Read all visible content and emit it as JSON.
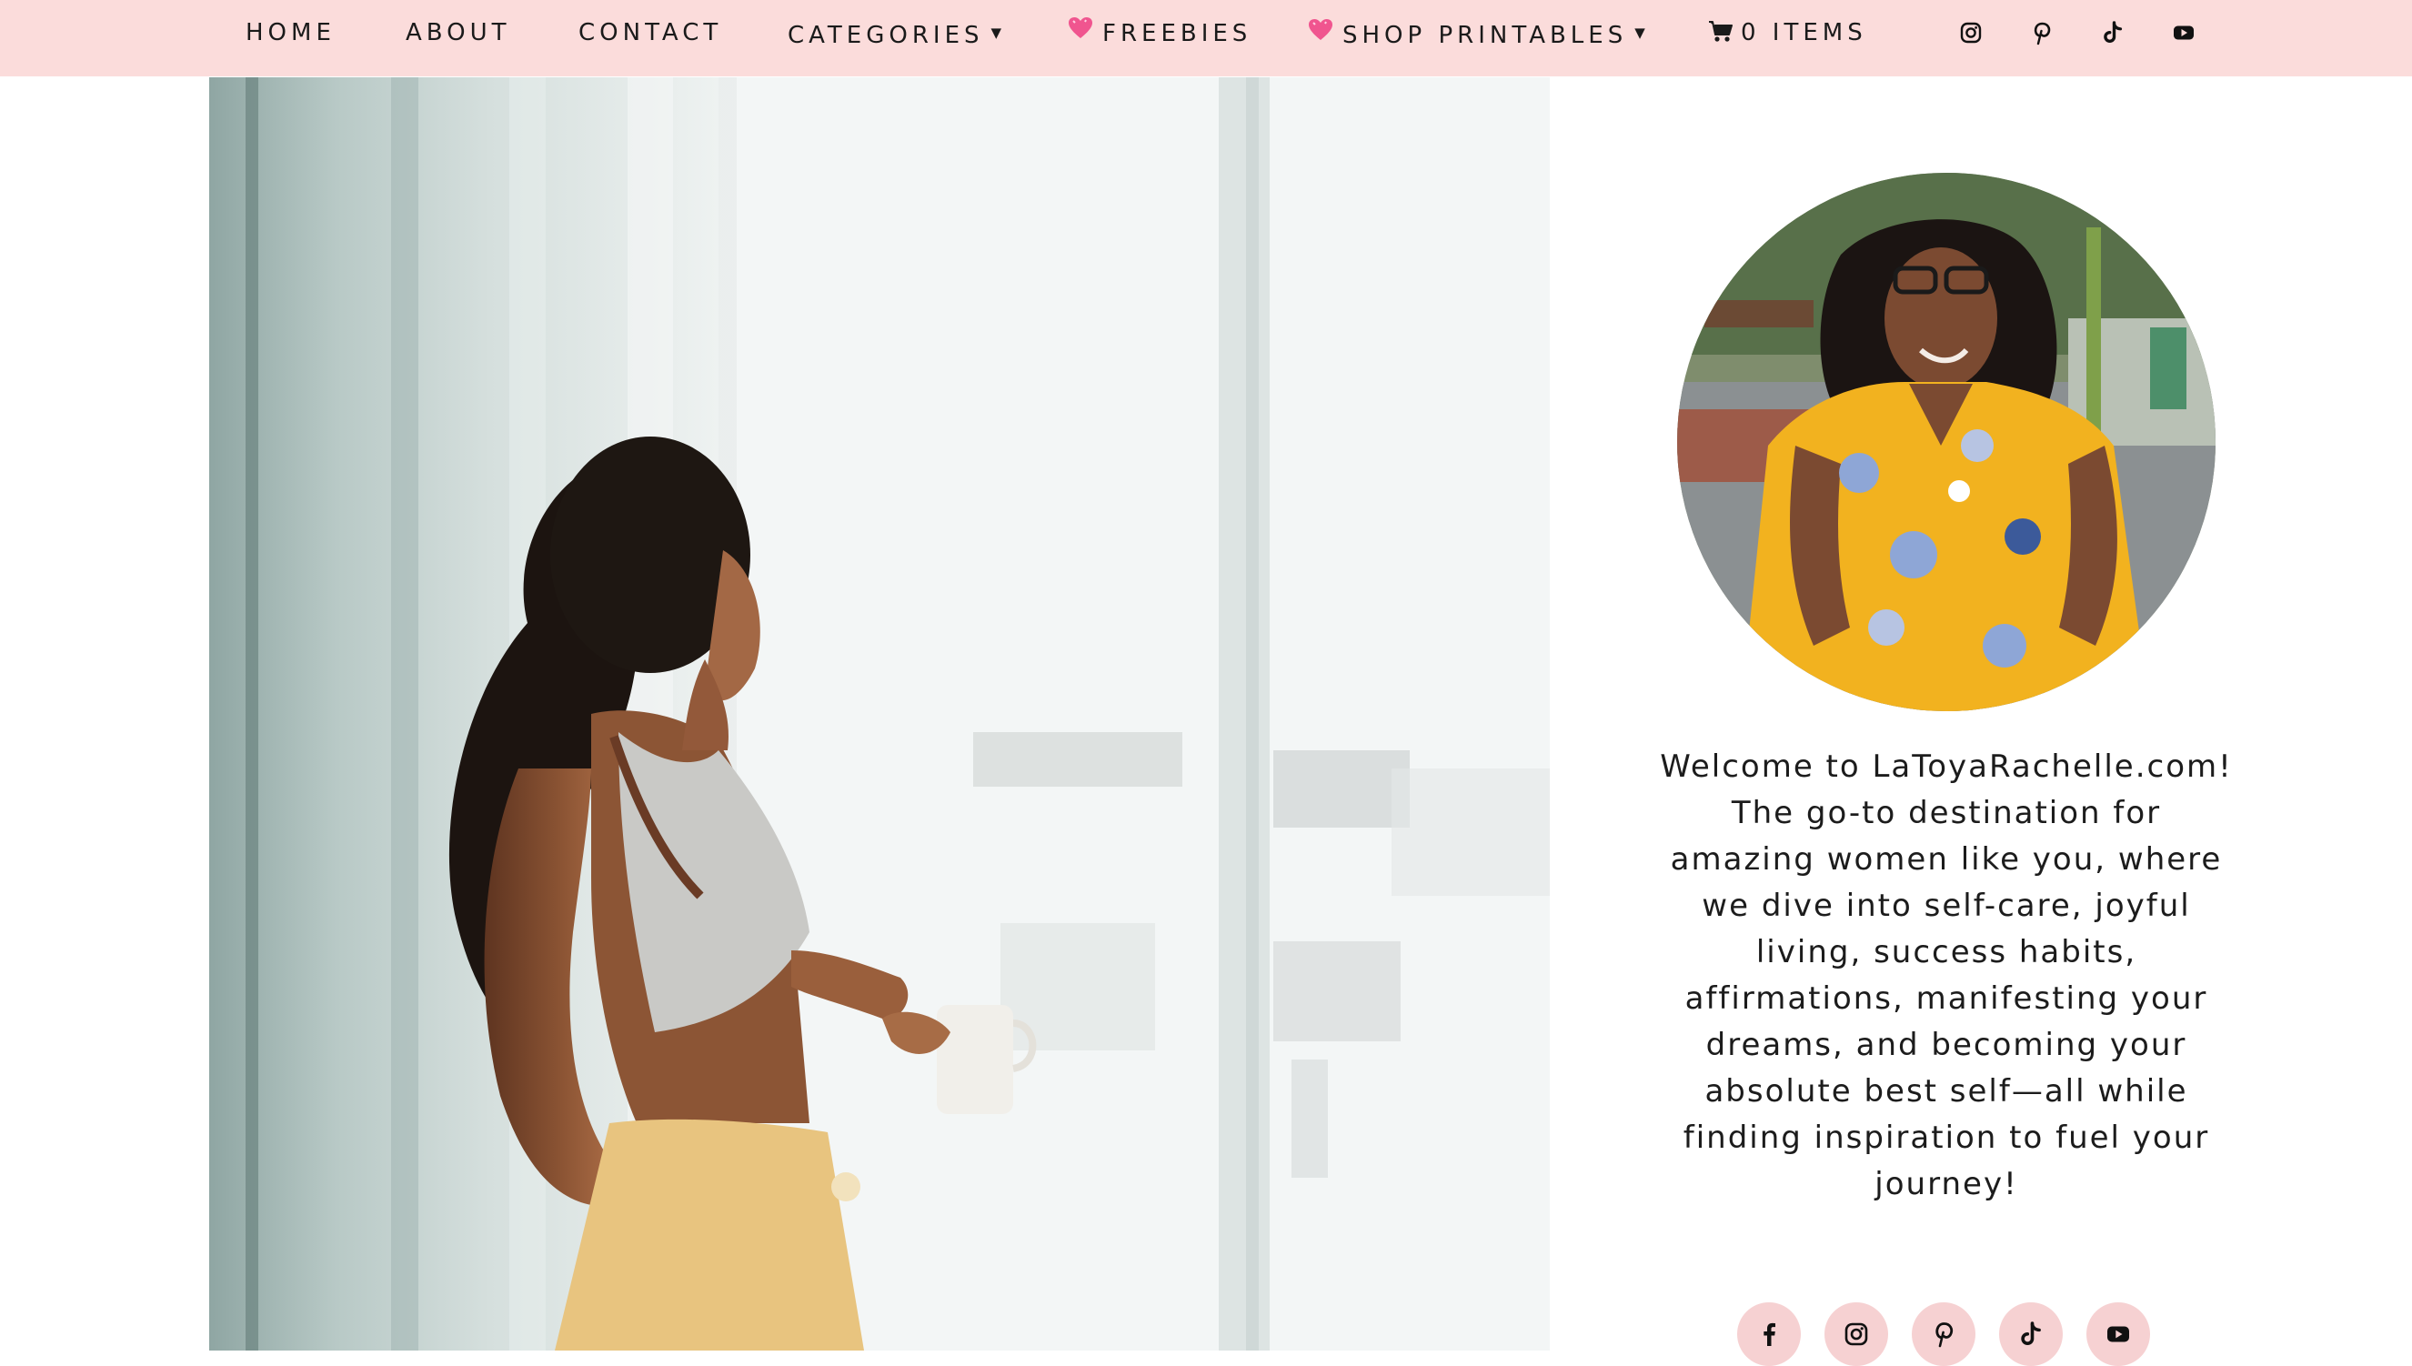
{
  "nav": {
    "items": [
      {
        "label": "HOME"
      },
      {
        "label": "ABOUT"
      },
      {
        "label": "CONTACT"
      },
      {
        "label": "CATEGORIES"
      },
      {
        "label": "FREEBIES"
      },
      {
        "label": "SHOP PRINTABLES"
      },
      {
        "label": "0 ITEMS"
      }
    ],
    "social_icons": [
      "instagram-icon",
      "pinterest-icon",
      "tiktok-icon",
      "youtube-icon"
    ]
  },
  "sidebar": {
    "welcome_text": "Welcome to LaToyaRachelle.com! The go-to destination for amazing women like you, where we dive into self-care, joyful living, success habits, affirmations, manifesting your dreams, and becoming your absolute best self—all while finding inspiration to fuel your journey!",
    "social_icons": [
      "facebook-icon",
      "instagram-icon",
      "pinterest-icon",
      "tiktok-icon",
      "youtube-icon"
    ]
  },
  "colors": {
    "nav_background": "#fbdcdb",
    "social_circle": "#f6d1d2",
    "text": "#1a1a1a"
  }
}
